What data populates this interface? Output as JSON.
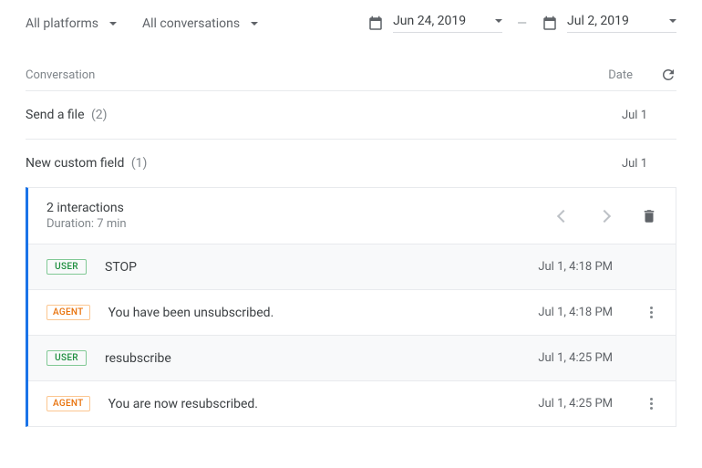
{
  "filters": {
    "platform_label": "All platforms",
    "conversations_label": "All conversations",
    "date_start": "Jun 24, 2019",
    "date_end": "Jul 2, 2019"
  },
  "headers": {
    "conversation": "Conversation",
    "date": "Date"
  },
  "conversations": [
    {
      "title": "Send a file",
      "count": "(2)",
      "date": "Jul 1"
    },
    {
      "title": "New custom field",
      "count": "(1)",
      "date": "Jul 1"
    }
  ],
  "expanded": {
    "interactions_label": "2 interactions",
    "duration_label": "Duration: 7 min",
    "messages": [
      {
        "role": "USER",
        "text": "STOP",
        "time": "Jul 1, 4:18 PM"
      },
      {
        "role": "AGENT",
        "text": "You have been unsubscribed.",
        "time": "Jul 1, 4:18 PM"
      },
      {
        "role": "USER",
        "text": "resubscribe",
        "time": "Jul 1, 4:25 PM"
      },
      {
        "role": "AGENT",
        "text": "You are now resubscribed.",
        "time": "Jul 1, 4:25 PM"
      }
    ]
  }
}
